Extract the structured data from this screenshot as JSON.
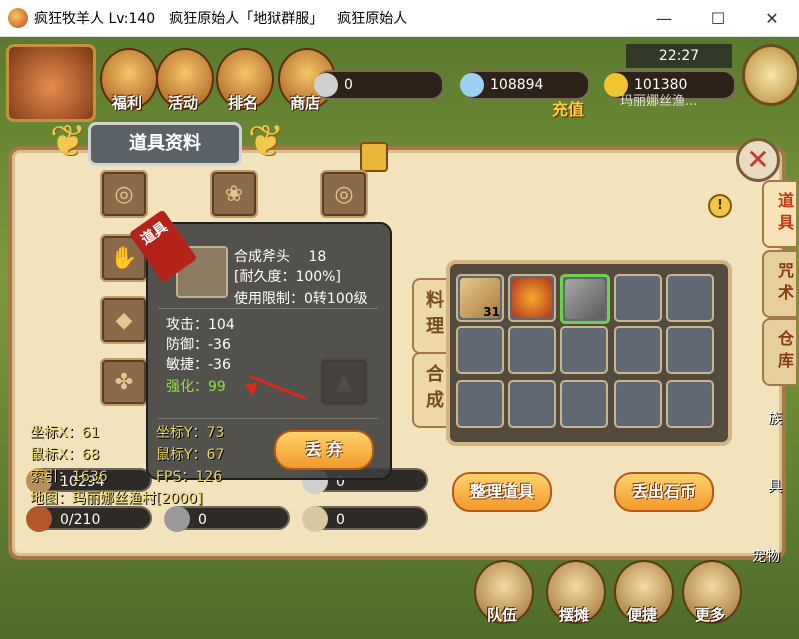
{
  "window": {
    "title_parts": [
      "疯狂牧羊人 Lv:140",
      "疯狂原始人「地狱群服」",
      "疯狂原始人"
    ],
    "controls": [
      "—",
      "☐",
      "✕"
    ]
  },
  "topbar": {
    "buttons": [
      "福利",
      "活动",
      "排名",
      "商店"
    ],
    "resources": {
      "silver": "0",
      "diamond": "108894",
      "gold": "101380"
    },
    "charge_label": "充值",
    "clock": "22:27",
    "npc_text": "玛丽娜丝渔..."
  },
  "panel": {
    "title": "道具资料",
    "side_tabs": [
      "道具",
      "咒术",
      "仓库"
    ],
    "mid_tabs": [
      "料理",
      "合成"
    ],
    "buttons": {
      "sort": "整理道具",
      "drop_stone": "丢出石币",
      "discard": "丢 弃"
    }
  },
  "bag": {
    "slots": [
      {
        "item": "wood-planks",
        "count": "31"
      },
      {
        "item": "fruit-bag",
        "count": ""
      },
      {
        "item": "composite-axe",
        "count": "",
        "selected": true
      },
      {
        "item": "",
        "count": ""
      },
      {
        "item": "",
        "count": ""
      },
      {
        "item": "",
        "count": ""
      },
      {
        "item": "",
        "count": ""
      },
      {
        "item": "",
        "count": ""
      },
      {
        "item": "",
        "count": ""
      },
      {
        "item": "",
        "count": ""
      },
      {
        "item": "",
        "count": ""
      },
      {
        "item": "",
        "count": ""
      },
      {
        "item": "",
        "count": ""
      },
      {
        "item": "",
        "count": ""
      },
      {
        "item": "",
        "count": ""
      }
    ]
  },
  "tooltip": {
    "ribbon": "道具",
    "name": "合成斧头",
    "level": "18",
    "durability": "[耐久度：100%]",
    "limit": "使用限制：0转100级",
    "attack": "攻击：104",
    "defense": "防御：-36",
    "agility": "敏捷：-36",
    "enhance": "强化：99"
  },
  "debug": {
    "coord_x": "坐标X：61",
    "mouse_x": "鼠标X：68",
    "index": "索引：1636",
    "map": "地图：玛丽娜丝渔村[2000]",
    "coord_y": "坐标Y：73",
    "mouse_y": "鼠标Y：67",
    "fps": "FPS：126"
  },
  "stats": {
    "meat": "0/210",
    "tool": "0",
    "shell": "0",
    "pill_a": "10294",
    "pill_b": "0",
    "pill_c": "0"
  },
  "bottom_bar": [
    "队伍",
    "摆摊",
    "便捷",
    "更多"
  ],
  "right_labels": [
    "族",
    "具",
    "宠物"
  ],
  "colors": {
    "accent": "#f29a2b",
    "panel": "#f3e3bd",
    "selected": "#6cd44a"
  }
}
